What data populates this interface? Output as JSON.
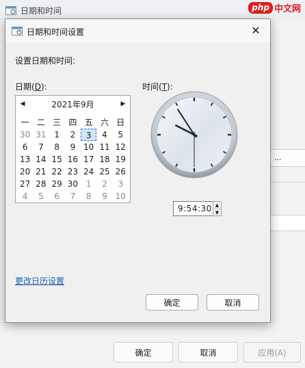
{
  "background_window": {
    "title": "日期和时间",
    "buttons": {
      "ok": "确定",
      "cancel": "取消",
      "apply": "应用(A)"
    },
    "side_button": "..."
  },
  "watermark": {
    "badge": "php",
    "text": "中文网"
  },
  "dialog": {
    "title": "日期和时间设置",
    "prompt": "设置日期和时间:",
    "date_label": "日期(",
    "date_key": "D",
    "date_suffix": "):",
    "time_label": "时间(",
    "time_key": "T",
    "time_suffix": "):",
    "calendar": {
      "month_title": "2021年9月",
      "weekdays": [
        "一",
        "二",
        "三",
        "四",
        "五",
        "六",
        "日"
      ],
      "weeks": [
        [
          "30",
          "31",
          "1",
          "2",
          "3",
          "4",
          "5"
        ],
        [
          "6",
          "7",
          "8",
          "9",
          "10",
          "11",
          "12"
        ],
        [
          "13",
          "14",
          "15",
          "16",
          "17",
          "18",
          "19"
        ],
        [
          "20",
          "21",
          "22",
          "23",
          "24",
          "25",
          "26"
        ],
        [
          "27",
          "28",
          "29",
          "30",
          "1",
          "2",
          "3"
        ],
        [
          "4",
          "5",
          "6",
          "7",
          "8",
          "9",
          "10"
        ]
      ],
      "selected_day": "3"
    },
    "clock": {
      "hour": 9,
      "minute": 54,
      "second": 30
    },
    "time_value": "9:54:30",
    "change_calendar_link": "更改日历设置",
    "ok_button": "确定",
    "cancel_button": "取消"
  }
}
